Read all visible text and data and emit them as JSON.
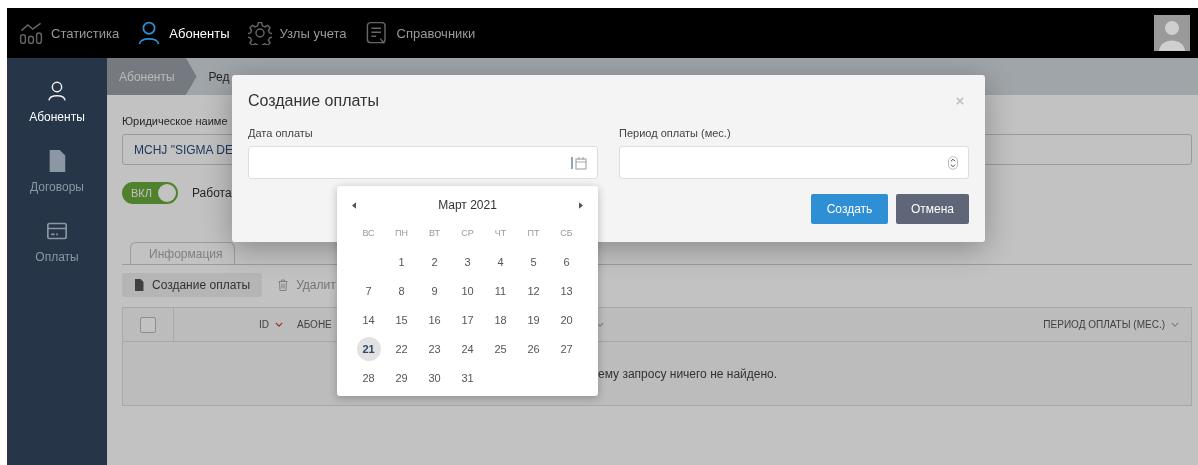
{
  "top_nav": {
    "items": [
      {
        "kind": "chart",
        "label": "Статистика",
        "selected": false
      },
      {
        "kind": "user",
        "label": "Абоненты",
        "selected": true
      },
      {
        "kind": "gear",
        "label": "Узлы учета",
        "selected": false
      },
      {
        "kind": "list",
        "label": "Справочники",
        "selected": false
      }
    ]
  },
  "sidebar": {
    "items": [
      {
        "kind": "user",
        "label": "Абоненты",
        "selected": true
      },
      {
        "kind": "document",
        "label": "Договоры",
        "selected": false
      },
      {
        "kind": "card",
        "label": "Оплаты",
        "selected": false
      }
    ]
  },
  "breadcrumb": [
    {
      "label": "Абоненты"
    },
    {
      "label": "Ред"
    }
  ],
  "form": {
    "legal_name_label": "Юридическое наиме",
    "legal_name_value": "MCHJ \"SIGMA DE",
    "toggle": {
      "label": "ВКЛ",
      "on": true
    },
    "status_label": "Работа"
  },
  "tabs": [
    {
      "label": "Информация",
      "selected": false
    }
  ],
  "toolbar": [
    {
      "kind": "create",
      "label": "Создание оплаты"
    },
    {
      "kind": "delete",
      "label": "Удалит"
    }
  ],
  "table": {
    "select_all_checked": false,
    "columns": [
      {
        "label": "ID",
        "active": true
      },
      {
        "label": "АБОНЕ"
      },
      {
        "active": false
      },
      {
        "label": "ПЕРИОД ОПЛАТЫ (МЕС.)",
        "active": false
      }
    ],
    "empty_message": "ему запросу ничего не найдено."
  },
  "modal": {
    "title": "Создание оплаты",
    "fields": [
      {
        "kind": "date",
        "label": "Дата оплаты"
      },
      {
        "kind": "number",
        "label": "Период оплаты (мес.)"
      }
    ],
    "buttons": [
      {
        "kind": "primary",
        "label": "Создать"
      },
      {
        "kind": "secondary",
        "label": "Отмена"
      }
    ]
  },
  "calendar": {
    "month": "Март 2021",
    "weekdays": [
      "ВС",
      "ПН",
      "ВТ",
      "СР",
      "ЧТ",
      "ПТ",
      "СБ"
    ],
    "weeks": [
      [
        {
          "label": "1",
          "selected": false
        },
        {
          "label": "2",
          "selected": false
        },
        {
          "label": "3",
          "selected": false
        },
        {
          "label": "4",
          "selected": false
        },
        {
          "label": "5",
          "selected": false
        },
        {
          "label": "6",
          "selected": false
        }
      ],
      [
        {
          "label": "7",
          "selected": false
        },
        {
          "label": "8",
          "selected": false
        },
        {
          "label": "9",
          "selected": false
        },
        {
          "label": "10",
          "selected": false
        },
        {
          "label": "11",
          "selected": false
        },
        {
          "label": "12",
          "selected": false
        },
        {
          "label": "13",
          "selected": false
        }
      ],
      [
        {
          "label": "14",
          "selected": false
        },
        {
          "label": "15",
          "selected": false
        },
        {
          "label": "16",
          "selected": false
        },
        {
          "label": "17",
          "selected": false
        },
        {
          "label": "18",
          "selected": false
        },
        {
          "label": "19",
          "selected": false
        },
        {
          "label": "20",
          "selected": false
        }
      ],
      [
        {
          "label": "21",
          "selected": true
        },
        {
          "label": "22",
          "selected": false
        },
        {
          "label": "23",
          "selected": false
        },
        {
          "label": "24",
          "selected": false
        },
        {
          "label": "25",
          "selected": false
        },
        {
          "label": "26",
          "selected": false
        },
        {
          "label": "27",
          "selected": false
        }
      ],
      [
        {
          "label": "28",
          "selected": false
        },
        {
          "label": "29",
          "selected": false
        },
        {
          "label": "30",
          "selected": false
        },
        {
          "label": "31",
          "selected": false
        }
      ]
    ]
  }
}
